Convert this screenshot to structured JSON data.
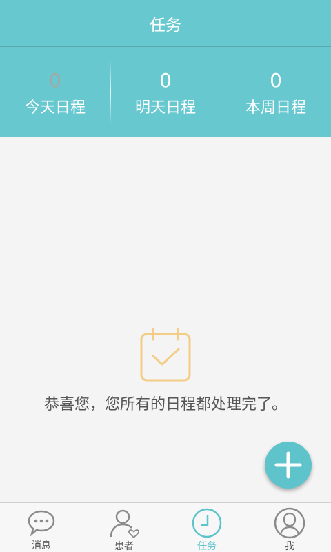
{
  "header": {
    "title": "任务"
  },
  "stats": [
    {
      "count": "0",
      "label": "今天日程"
    },
    {
      "count": "0",
      "label": "明天日程"
    },
    {
      "count": "0",
      "label": "本周日程"
    }
  ],
  "empty_state": {
    "icon": "calendar-check-icon",
    "message": "恭喜您，您所有的日程都处理完了。"
  },
  "fab": {
    "icon": "plus-icon"
  },
  "tabs": [
    {
      "label": "消息",
      "icon": "chat-bubble-icon",
      "active": false
    },
    {
      "label": "患者",
      "icon": "patient-icon",
      "active": false
    },
    {
      "label": "任务",
      "icon": "clock-icon",
      "active": true
    },
    {
      "label": "我",
      "icon": "user-icon",
      "active": false
    }
  ],
  "colors": {
    "primary": "#68c8d0",
    "accent": "#5fc3cb",
    "calendar_icon": "#f3cc86",
    "background": "#f4f4f4"
  }
}
